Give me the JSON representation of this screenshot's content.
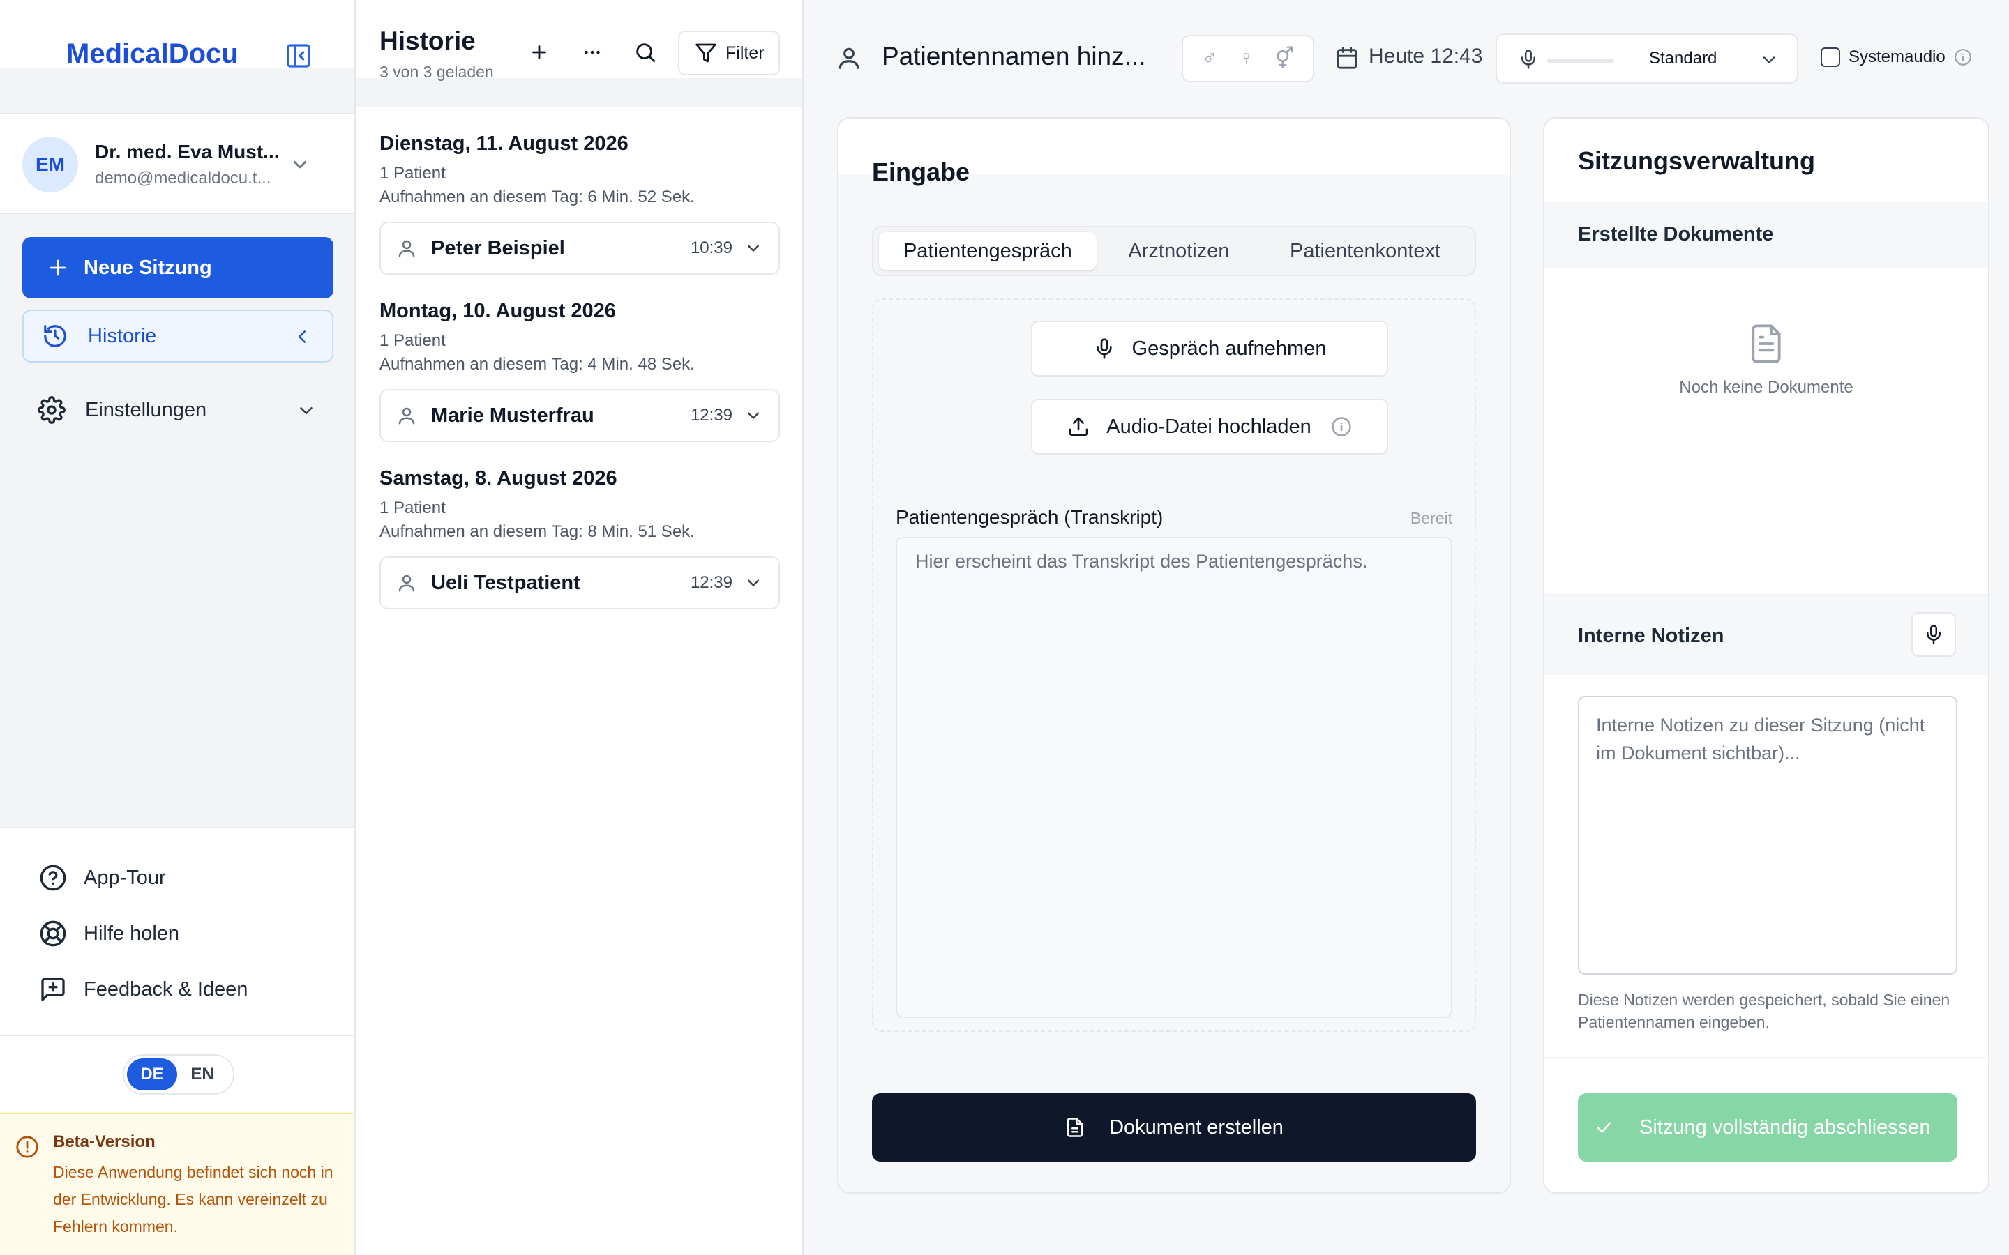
{
  "sidebar": {
    "logo": "MedicalDocu",
    "user": {
      "initials": "EM",
      "name": "Dr. med. Eva Must...",
      "email": "demo@medicaldocu.t..."
    },
    "new_session": "Neue Sitzung",
    "history": "Historie",
    "settings": "Einstellungen",
    "links": {
      "tour": "App-Tour",
      "help": "Hilfe holen",
      "feedback": "Feedback & Ideen"
    },
    "lang": {
      "de": "DE",
      "en": "EN",
      "active": "DE"
    },
    "beta": {
      "title": "Beta-Version",
      "text": "Diese Anwendung befindet sich noch in der Entwicklung. Es kann vereinzelt zu Fehlern kommen."
    }
  },
  "history": {
    "title": "Historie",
    "subtitle": "3 von 3 geladen",
    "filter": "Filter",
    "days": [
      {
        "title": "Dienstag, 11. August 2026",
        "count": "1 Patient",
        "recording": "Aufnahmen an diesem Tag: 6 Min. 52 Sek.",
        "patient": "Peter Beispiel",
        "time": "10:39"
      },
      {
        "title": "Montag, 10. August 2026",
        "count": "1 Patient",
        "recording": "Aufnahmen an diesem Tag: 4 Min. 48 Sek.",
        "patient": "Marie Musterfrau",
        "time": "12:39"
      },
      {
        "title": "Samstag, 8. August 2026",
        "count": "1 Patient",
        "recording": "Aufnahmen an diesem Tag: 8 Min. 51 Sek.",
        "patient": "Ueli Testpatient",
        "time": "12:39"
      }
    ]
  },
  "topbar": {
    "patient_name": "Patientennamen hinz...",
    "gender_symbols": [
      "♂",
      "♀",
      "⚥"
    ],
    "date": "Heute 12:43",
    "audio_level": 0,
    "audio_mode": "Standard",
    "system_audio": "Systemaudio"
  },
  "eingabe": {
    "title": "Eingabe",
    "tabs": [
      "Patientengespräch",
      "Arztnotizen",
      "Patientenkontext"
    ],
    "active_tab": 0,
    "record_button": "Gespräch aufnehmen",
    "upload_button": "Audio-Datei hochladen",
    "transcript_label": "Patientengespräch (Transkript)",
    "transcript_status": "Bereit",
    "transcript_placeholder": "Hier erscheint das Transkript des Patientengesprächs.",
    "create_button": "Dokument erstellen"
  },
  "session": {
    "title": "Sitzungsverwaltung",
    "docs_title": "Erstellte Dokumente",
    "docs_empty": "Noch keine Dokumente",
    "notes_title": "Interne Notizen",
    "notes_placeholder": "Interne Notizen zu dieser Sitzung (nicht im Dokument sichtbar)...",
    "notes_hint": "Diese Notizen werden gespeichert, sobald Sie einen Patientennamen eingeben.",
    "close_button": "Sitzung vollständig abschliessen"
  },
  "colors": {
    "brand": "#1d4ed8",
    "primary_button": "#1d5be0",
    "dark_button": "#0f172a",
    "success_button_disabled": "#86d6a6",
    "beta_background": "#fefbeb"
  }
}
